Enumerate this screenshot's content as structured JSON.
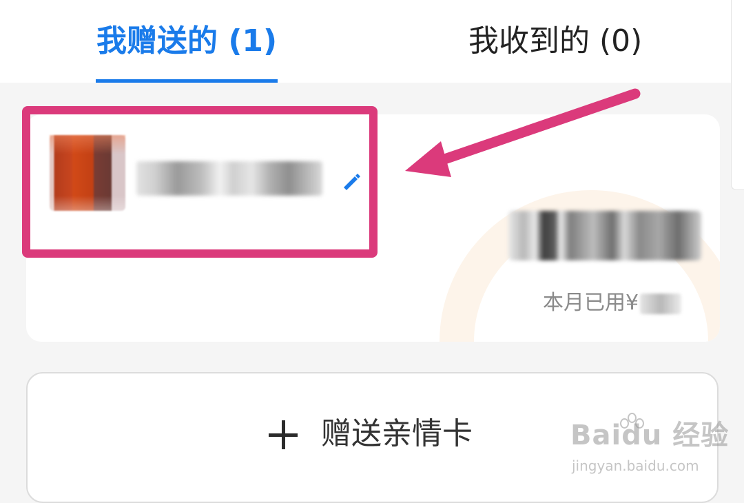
{
  "tabs": {
    "sent": "我赠送的 (1)",
    "received": "我收到的 (0)"
  },
  "card": {
    "used_label": "本月已用¥"
  },
  "gift_button": {
    "label": "赠送亲情卡"
  },
  "watermark": {
    "brand": "Baidu 经验",
    "url": "jingyan.baidu.com"
  },
  "colors": {
    "accent": "#1a7bea",
    "annotation": "#db3a7b"
  },
  "icons": {
    "edit": "pencil-icon",
    "add": "plus-icon"
  }
}
